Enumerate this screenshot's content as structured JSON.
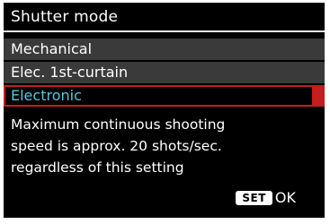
{
  "screen": {
    "title": "Shutter mode",
    "options": [
      {
        "label": "Mechanical",
        "selected": false
      },
      {
        "label": "Elec. 1st-curtain",
        "selected": false
      },
      {
        "label": "Electronic",
        "selected": true
      }
    ],
    "description_lines": [
      "Maximum continuous shooting",
      "speed is approx. 20 shots/sec.",
      "regardless of this setting"
    ],
    "set_button_label": "SET",
    "ok_label": "OK",
    "colors": {
      "background": "#000000",
      "unselected_item": "#3a3a3a",
      "selected_text": "#56c7e0",
      "selection_border": "#c41d1d"
    }
  }
}
